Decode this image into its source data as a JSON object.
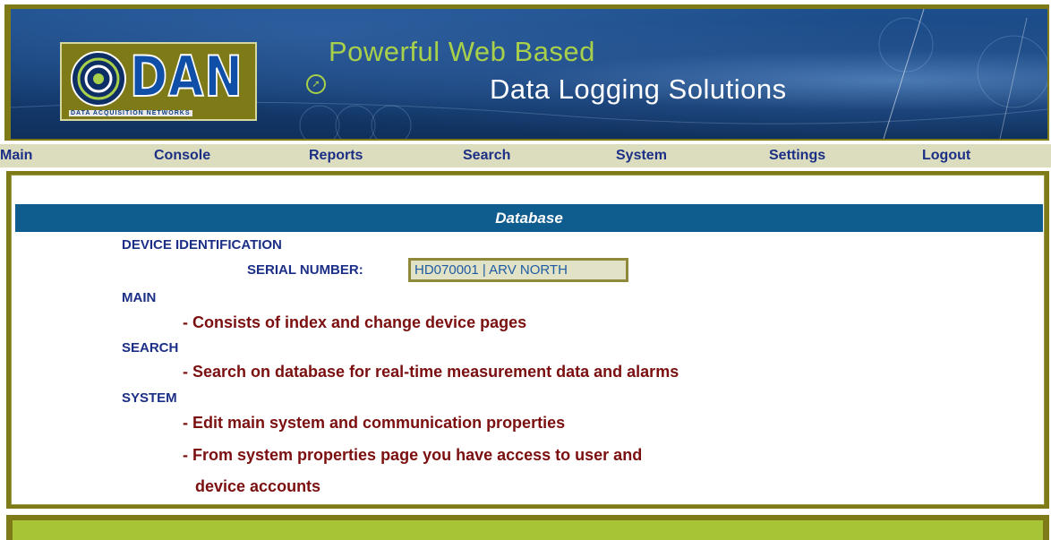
{
  "banner": {
    "logo_text": "DAN",
    "logo_subtitle": "DATA ACQUISITION NETWORKS",
    "tagline_line1": "Powerful Web Based",
    "tagline_line2": "Data Logging Solutions"
  },
  "nav": {
    "items": [
      {
        "label": "Main"
      },
      {
        "label": "Console"
      },
      {
        "label": "Reports"
      },
      {
        "label": "Search"
      },
      {
        "label": "System"
      },
      {
        "label": "Settings"
      },
      {
        "label": "Logout"
      }
    ]
  },
  "content": {
    "header": "Database",
    "device_identification": "DEVICE IDENTIFICATION",
    "serial_label": "SERIAL NUMBER:",
    "serial_value": "HD070001 | ARV NORTH",
    "main_title": "MAIN",
    "main_desc": "- Consists of index and change device pages",
    "search_title": "SEARCH",
    "search_desc": "- Search on database for real-time measurement data and alarms",
    "system_title": "SYSTEM",
    "system_desc1": "- Edit main system and communication properties",
    "system_desc2_line1": "- From system properties page you have access to user and",
    "system_desc2_line2": "device accounts"
  },
  "colors": {
    "frame_olive": "#7d7a17",
    "nav_background": "#dcdcbe",
    "nav_text": "#1b2f86",
    "header_bar": "#0f5c8f",
    "description_text": "#7b0f0f",
    "footer_green": "#a6c435",
    "tagline_green": "#a8d04a"
  }
}
